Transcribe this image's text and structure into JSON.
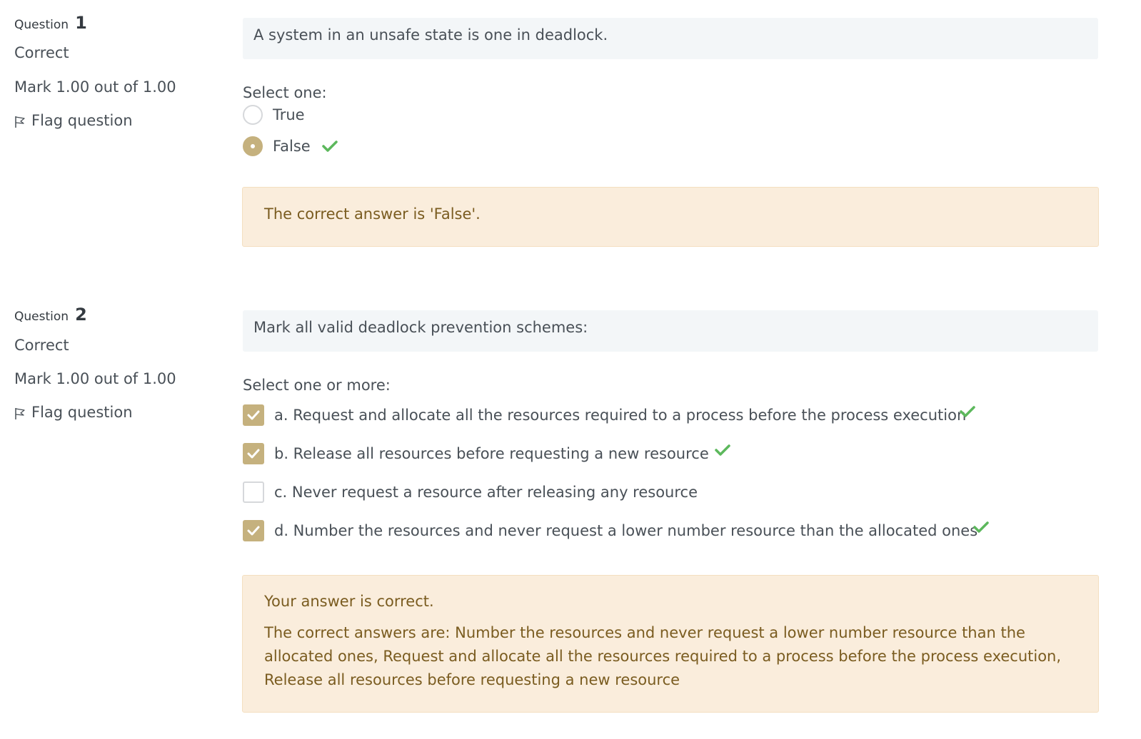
{
  "questions": [
    {
      "question_word": "Question",
      "number": "1",
      "state": "Correct",
      "grade": "Mark 1.00 out of 1.00",
      "flag_label": "Flag question",
      "text": "A system in an unsafe state is one in deadlock.",
      "prompt": "Select one:",
      "options": [
        {
          "label": "True",
          "checked": false,
          "correct_mark": false
        },
        {
          "label": "False",
          "checked": true,
          "correct_mark": true
        }
      ],
      "feedback": {
        "right_answer": "The correct answer is 'False'."
      }
    },
    {
      "question_word": "Question",
      "number": "2",
      "state": "Correct",
      "grade": "Mark 1.00 out of 1.00",
      "flag_label": "Flag question",
      "text": "Mark all valid deadlock prevention schemes:",
      "prompt": "Select one or more:",
      "options": [
        {
          "label": "a. Request and allocate all the resources required to a process before the process execution",
          "checked": true,
          "correct_mark": true
        },
        {
          "label": "b. Release all resources before requesting a new resource",
          "checked": true,
          "correct_mark": true
        },
        {
          "label": "c. Never request a resource after releasing any resource",
          "checked": false,
          "correct_mark": false
        },
        {
          "label": "d. Number the resources and never request a lower number resource than the allocated ones",
          "checked": true,
          "correct_mark": true
        }
      ],
      "feedback": {
        "general": "Your answer is correct.",
        "right_answer": "The correct answers are: Number the resources and never request a lower number resource than the allocated ones, Request and allocate all the resources required to a process before the process execution, Release all resources before requesting a new resource"
      }
    }
  ],
  "colors": {
    "accent": "#c5b17e",
    "correct_tick": "#5cb85c",
    "feedback_bg": "#faeddc",
    "qtext_bg": "#f3f6f8"
  },
  "icons": {
    "flag": "flag-outline-icon",
    "tick": "check-icon"
  }
}
